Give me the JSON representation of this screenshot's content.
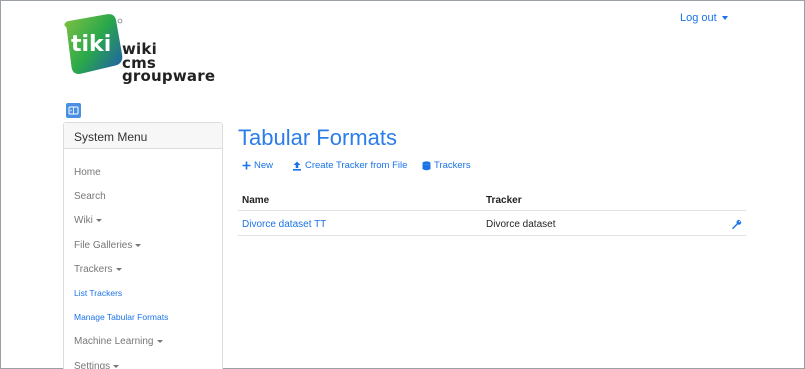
{
  "header": {
    "logo": {
      "brand": "tiki",
      "lines": [
        "wiki",
        "cms",
        "groupware"
      ]
    },
    "logout_label": "Log out"
  },
  "system_menu": {
    "title": "System Menu",
    "items": [
      {
        "label": "Home",
        "dropdown": false,
        "link": false
      },
      {
        "label": "Search",
        "dropdown": false,
        "link": false
      },
      {
        "label": "Wiki",
        "dropdown": true,
        "link": false
      },
      {
        "label": "File Galleries",
        "dropdown": true,
        "link": false
      },
      {
        "label": "Trackers",
        "dropdown": true,
        "link": false
      },
      {
        "label": "List Trackers",
        "dropdown": false,
        "link": true
      },
      {
        "label": "Manage Tabular Formats",
        "dropdown": false,
        "link": true
      },
      {
        "label": "Machine Learning",
        "dropdown": true,
        "link": false
      },
      {
        "label": "Settings",
        "dropdown": true,
        "link": false
      }
    ]
  },
  "main": {
    "title": "Tabular Formats",
    "actions": {
      "new_label": "New",
      "create_label": "Create Tracker from File",
      "trackers_label": "Trackers"
    },
    "table": {
      "headers": {
        "name": "Name",
        "tracker": "Tracker"
      },
      "rows": [
        {
          "name": "Divorce dataset TT",
          "tracker": "Divorce dataset"
        }
      ]
    }
  },
  "colors": {
    "accent": "#1a73e8",
    "title": "#2b7de9",
    "logo_green": "#2aa84a",
    "logo_blue": "#1f5fa8"
  }
}
